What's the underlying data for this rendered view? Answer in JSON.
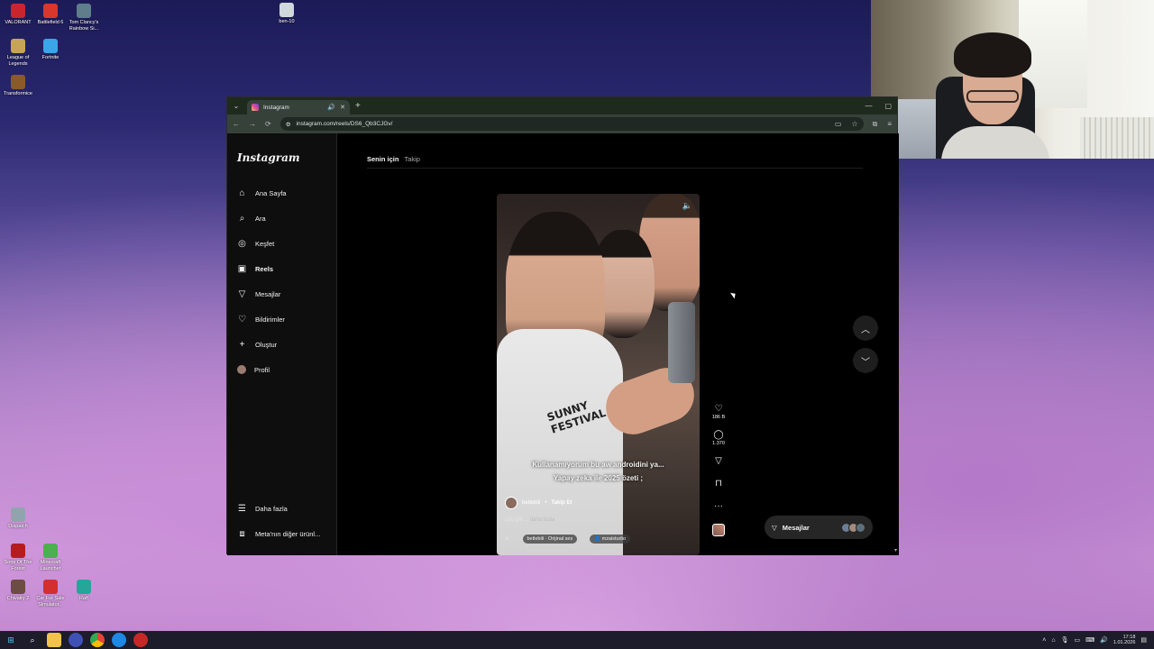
{
  "desktop": {
    "icons_top": [
      {
        "label": "VALORANT",
        "color": "#c9252f"
      },
      {
        "label": "Battlefield 6",
        "color": "#d8372c"
      },
      {
        "label": "Tom Clancy's Rainbow Si...",
        "color": "#607d8b"
      },
      {
        "label": "League of Legends",
        "color": "#c8a556"
      },
      {
        "label": "Fortnite",
        "color": "#3aa5e8"
      },
      {
        "label": "Transformice",
        "color": "#8b5a2b"
      },
      {
        "label": "ben-10",
        "color": "#cfd8dc"
      }
    ],
    "icons_bottom": [
      {
        "label": "Dispatch",
        "color": "#90a4ae"
      },
      {
        "label": "Sons Of The Forest",
        "color": "#b71c1c"
      },
      {
        "label": "Minecraft Launcher",
        "color": "#4caf50"
      },
      {
        "label": "Chivalry 2",
        "color": "#6d4c41"
      },
      {
        "label": "Car For Sale Simulator...",
        "color": "#d32f2f"
      },
      {
        "label": "Raft",
        "color": "#26a69a"
      }
    ]
  },
  "browser": {
    "tab_title": "Instagram",
    "url": "instagram.com/reels/DS6_Qb3CJGv/"
  },
  "instagram": {
    "logo": "Instagram",
    "nav": [
      {
        "label": "Ana Sayfa",
        "icon": "home-icon"
      },
      {
        "label": "Ara",
        "icon": "search-icon"
      },
      {
        "label": "Keşfet",
        "icon": "explore-icon"
      },
      {
        "label": "Reels",
        "icon": "reels-icon"
      },
      {
        "label": "Mesajlar",
        "icon": "messages-icon"
      },
      {
        "label": "Bildirimler",
        "icon": "heart-icon"
      },
      {
        "label": "Oluştur",
        "icon": "plus-icon"
      },
      {
        "label": "Profil",
        "icon": "profile-avatar"
      }
    ],
    "nav_bottom": [
      {
        "label": "Daha fazla",
        "icon": "menu-icon"
      },
      {
        "label": "Meta'nın diğer ürünl...",
        "icon": "meta-icon"
      }
    ],
    "feed_tabs": {
      "active": "Senin için",
      "inactive": "Takip"
    },
    "reel": {
      "caption_line1": "Kullanamıyorum bu aw androidini ya...",
      "caption_line2": "Yapay zeka ile 2025 özeti ;",
      "author": "betlebili",
      "follow": "Takip Et",
      "description": "çok iyiii ...",
      "more": "daha fazla",
      "audio": "betlebili · Orijinal ses",
      "collab": "mzaistudio",
      "shirt_text": "SUNNY FESTIVAL"
    },
    "actions": {
      "likes": "186 B",
      "comments": "1.370"
    },
    "messages_pill": "Mesajlar"
  },
  "taskbar": {
    "time": "17:18",
    "date": "1.01.2026"
  }
}
